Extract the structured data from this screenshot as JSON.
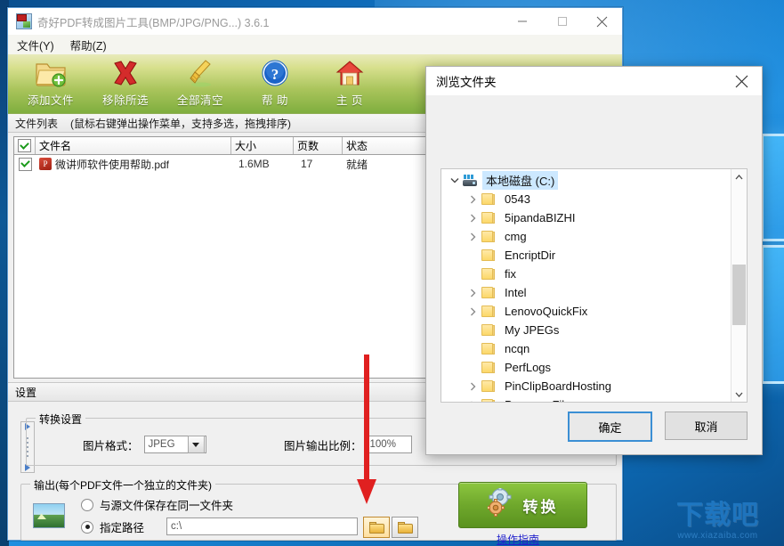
{
  "app": {
    "title": "奇好PDF转成图片工具(BMP/JPG/PNG...) 3.6.1",
    "icon": "pdf-image-app-icon",
    "window_buttons": {
      "minimize": "minimize-icon",
      "maximize": "maximize-icon",
      "close": "close-icon"
    },
    "menu": [
      {
        "label": "文件(Y)",
        "name": "menu-file"
      },
      {
        "label": "帮助(Z)",
        "name": "menu-help"
      }
    ],
    "toolbar": [
      {
        "label": "添加文件",
        "icon": "add-folder-icon",
        "name": "toolbar-add-file"
      },
      {
        "label": "移除所选",
        "icon": "red-cross-icon",
        "name": "toolbar-remove-selected"
      },
      {
        "label": "全部清空",
        "icon": "broom-icon",
        "name": "toolbar-clear-all"
      },
      {
        "label": "帮 助",
        "icon": "question-help-icon",
        "name": "toolbar-help"
      },
      {
        "label": "主 页",
        "icon": "home-icon",
        "name": "toolbar-home"
      }
    ],
    "file_list": {
      "section_title": "文件列表",
      "section_hint": "(鼠标右键弹出操作菜单，支持多选，拖拽排序)",
      "columns": [
        "",
        "文件名",
        "大小",
        "页数",
        "状态"
      ],
      "rows": [
        {
          "checked": true,
          "name": "微讲师软件使用帮助.pdf",
          "size": "1.6MB",
          "pages": "17",
          "status": "就绪"
        }
      ]
    },
    "settings": {
      "section_title": "设置",
      "convert_group_title": "转换设置",
      "format_label": "图片格式：",
      "format_value": "JPEG",
      "scale_label": "图片输出比例：",
      "scale_value": "100%",
      "output_group_title": "输出(每个PDF文件一个独立的文件夹)",
      "option_same_folder": "与源文件保存在同一文件夹",
      "option_specify_path": "指定路径",
      "path_value": "c:\\",
      "browse_button": "browse-folder-icon",
      "open_button": "open-folder-icon",
      "preview_icon": "image-preview-icon"
    },
    "convert": {
      "label": "转换",
      "icon": "gears-icon",
      "guide_link": "操作指南"
    }
  },
  "dialog": {
    "title": "浏览文件夹",
    "close_icon": "close-icon",
    "tree": [
      {
        "label": "本地磁盘 (C:)",
        "icon": "drive-icon",
        "indent": 0,
        "expandable": true,
        "expanded": true,
        "selected": true
      },
      {
        "label": "0543",
        "icon": "folder-icon",
        "indent": 1,
        "expandable": true,
        "expanded": false,
        "selected": false
      },
      {
        "label": "5ipandaBIZHI",
        "icon": "folder-icon",
        "indent": 1,
        "expandable": true,
        "expanded": false,
        "selected": false
      },
      {
        "label": "cmg",
        "icon": "folder-icon",
        "indent": 1,
        "expandable": true,
        "expanded": false,
        "selected": false
      },
      {
        "label": "EncriptDir",
        "icon": "folder-icon",
        "indent": 1,
        "expandable": false,
        "expanded": false,
        "selected": false
      },
      {
        "label": "fix",
        "icon": "folder-icon",
        "indent": 1,
        "expandable": false,
        "expanded": false,
        "selected": false
      },
      {
        "label": "Intel",
        "icon": "folder-icon",
        "indent": 1,
        "expandable": true,
        "expanded": false,
        "selected": false
      },
      {
        "label": "LenovoQuickFix",
        "icon": "folder-icon",
        "indent": 1,
        "expandable": true,
        "expanded": false,
        "selected": false
      },
      {
        "label": "My JPEGs",
        "icon": "folder-icon",
        "indent": 1,
        "expandable": false,
        "expanded": false,
        "selected": false
      },
      {
        "label": "ncqn",
        "icon": "folder-icon",
        "indent": 1,
        "expandable": false,
        "expanded": false,
        "selected": false
      },
      {
        "label": "PerfLogs",
        "icon": "folder-icon",
        "indent": 1,
        "expandable": false,
        "expanded": false,
        "selected": false
      },
      {
        "label": "PinClipBoardHosting",
        "icon": "folder-icon",
        "indent": 1,
        "expandable": true,
        "expanded": false,
        "selected": false
      },
      {
        "label": "Program Files",
        "icon": "folder-icon",
        "indent": 1,
        "expandable": true,
        "expanded": false,
        "selected": false
      }
    ],
    "buttons": {
      "ok": "确定",
      "cancel": "取消"
    }
  },
  "watermark": {
    "text": "下载吧",
    "url": "www.xiazaiba.com"
  },
  "colors": {
    "accent_green": "#6fa82c",
    "desktop_blue": "#1070c0",
    "selection_blue": "#cce8ff",
    "annotation_red": "#e02020"
  }
}
